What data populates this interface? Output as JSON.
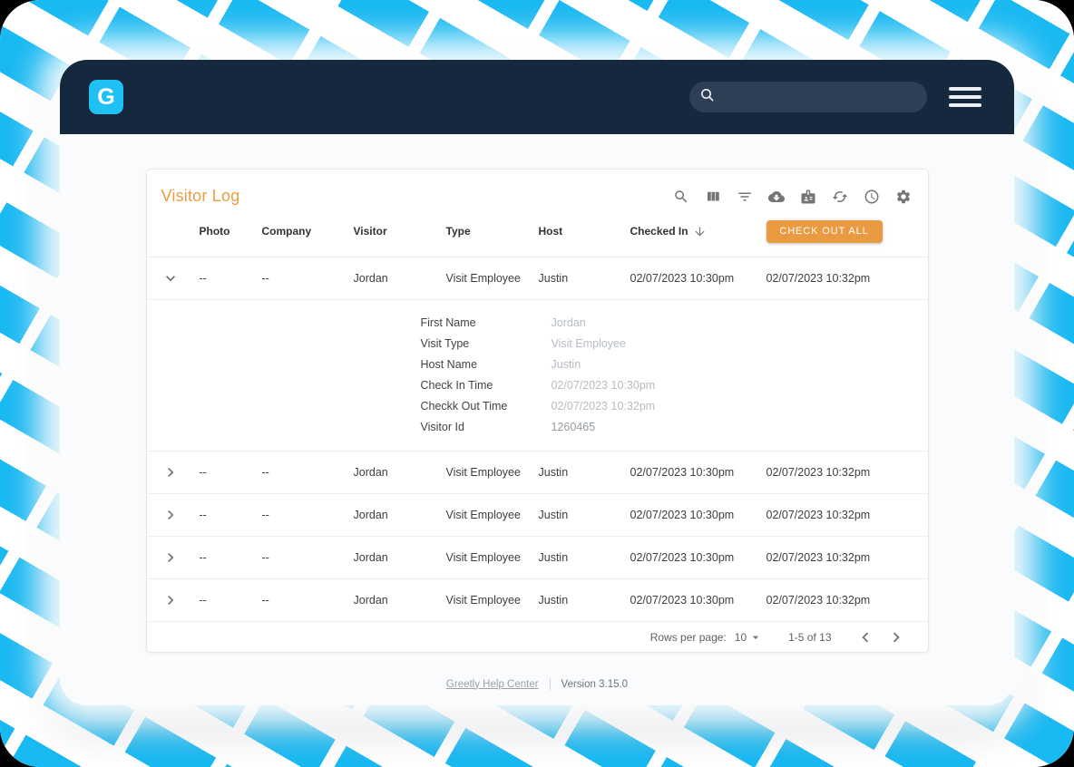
{
  "header": {
    "logo_text": "G"
  },
  "toolbar": {
    "icons": [
      "search",
      "view-columns",
      "filter",
      "cloud-download",
      "badge",
      "refresh",
      "history",
      "settings"
    ]
  },
  "panel": {
    "title": "Visitor Log",
    "table": {
      "columns": {
        "photo": "Photo",
        "company": "Company",
        "visitor": "Visitor",
        "type": "Type",
        "host": "Host",
        "checked_in": "Checked In"
      },
      "check_out_all_label": "CHECK OUT ALL",
      "rows": [
        {
          "photo": "--",
          "company": "--",
          "visitor": "Jordan",
          "type": "Visit Employee",
          "host": "Justin",
          "checked_in": "02/07/2023 10:30pm",
          "checked_out": "02/07/2023 10:32pm"
        },
        {
          "photo": "--",
          "company": "--",
          "visitor": "Jordan",
          "type": "Visit Employee",
          "host": "Justin",
          "checked_in": "02/07/2023 10:30pm",
          "checked_out": "02/07/2023 10:32pm"
        },
        {
          "photo": "--",
          "company": "--",
          "visitor": "Jordan",
          "type": "Visit Employee",
          "host": "Justin",
          "checked_in": "02/07/2023 10:30pm",
          "checked_out": "02/07/2023 10:32pm"
        },
        {
          "photo": "--",
          "company": "--",
          "visitor": "Jordan",
          "type": "Visit Employee",
          "host": "Justin",
          "checked_in": "02/07/2023 10:30pm",
          "checked_out": "02/07/2023 10:32pm"
        },
        {
          "photo": "--",
          "company": "--",
          "visitor": "Jordan",
          "type": "Visit Employee",
          "host": "Justin",
          "checked_in": "02/07/2023 10:30pm",
          "checked_out": "02/07/2023 10:32pm"
        }
      ],
      "details": [
        {
          "label": "First Name",
          "value": "Jordan"
        },
        {
          "label": "Visit Type",
          "value": "Visit Employee"
        },
        {
          "label": "Host Name",
          "value": "Justin"
        },
        {
          "label": "Check In Time",
          "value": "02/07/2023 10:30pm"
        },
        {
          "label": "Checkk Out Time",
          "value": "02/07/2023 10:32pm"
        },
        {
          "label": "Visitor Id",
          "value": "1260465"
        }
      ]
    },
    "pagination": {
      "rows_per_page_label": "Rows per page:",
      "rows_per_page_value": "10",
      "range_label": "1-5 of 13"
    }
  },
  "footer": {
    "help_center_label": "Greetly Help Center",
    "version_label": "Version 3.15.0"
  },
  "colors": {
    "brand_cyan": "#19B9F2",
    "navy": "#16283E",
    "accent_orange": "#EF9B40",
    "button_orange": "#EA9A40"
  }
}
